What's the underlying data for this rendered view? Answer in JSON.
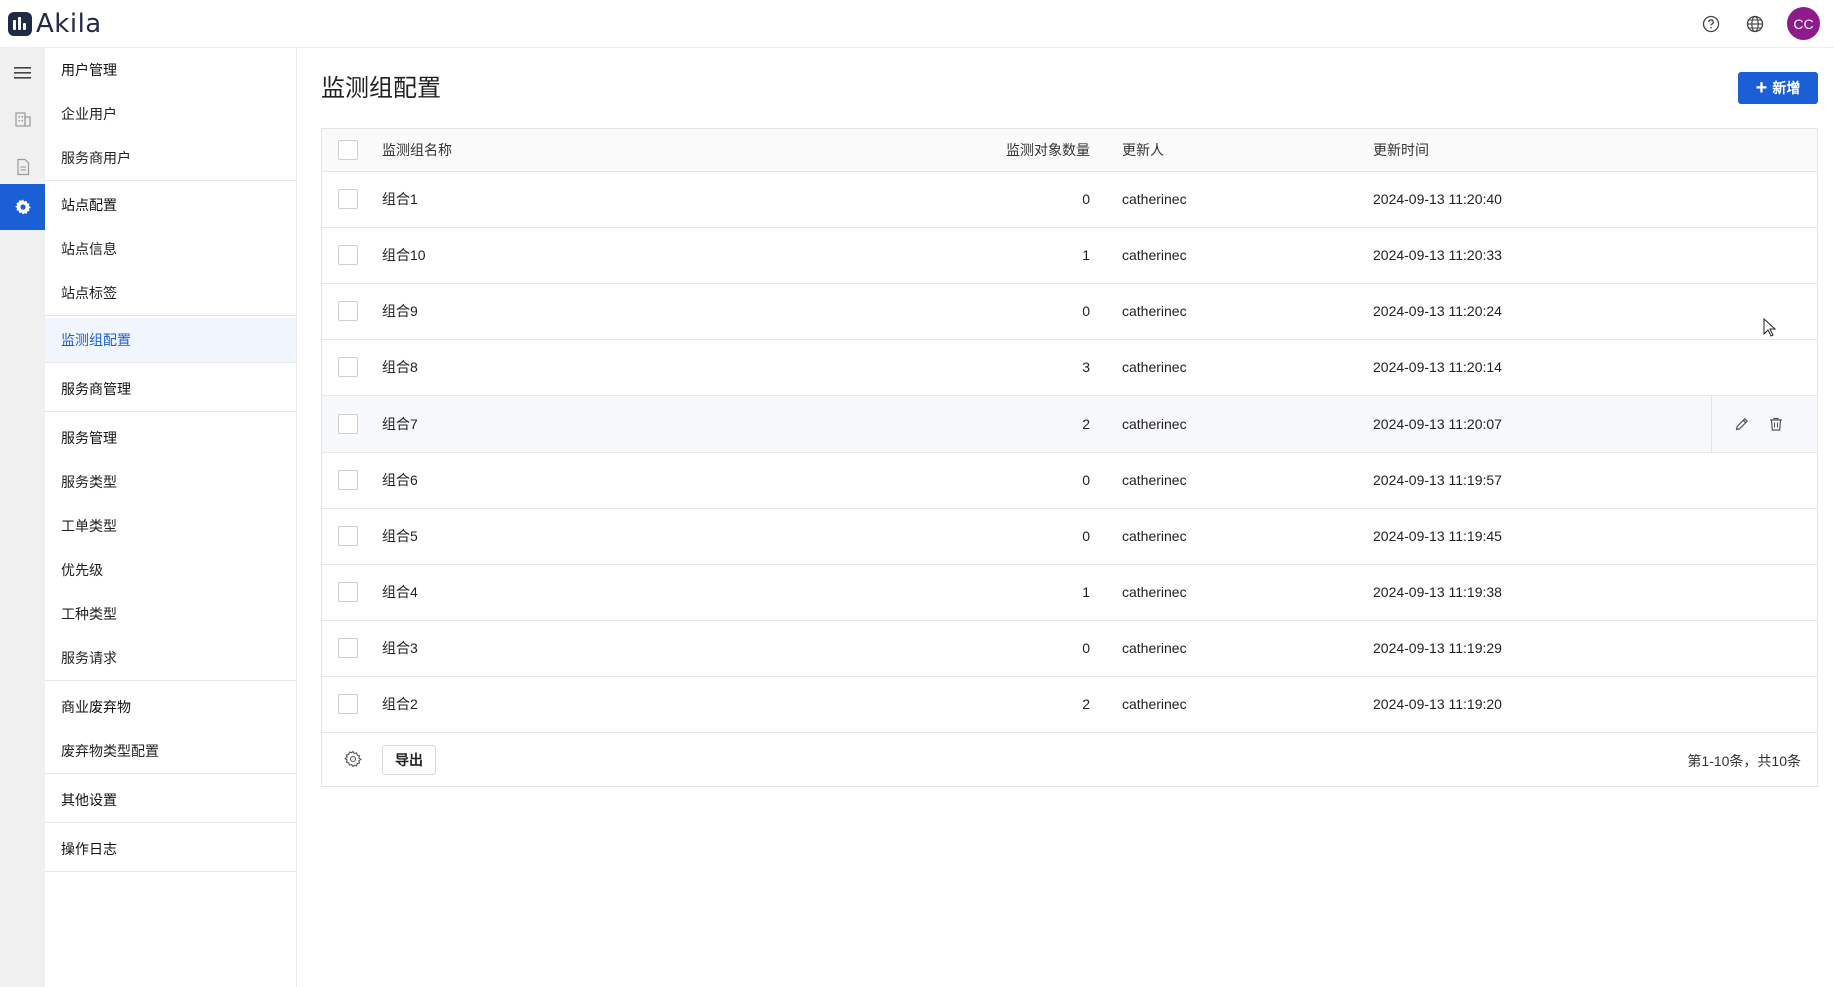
{
  "app": {
    "logo_text": "Akila",
    "avatar_initials": "CC"
  },
  "topbar": {
    "icons": [
      "help-icon",
      "globe-icon"
    ]
  },
  "rail": {
    "icons": [
      "menu-icon",
      "building-icon",
      "document-icon",
      "gear-icon"
    ],
    "active": "gear-icon"
  },
  "sidebar": {
    "groups": [
      {
        "items": [
          {
            "label": "用户管理"
          },
          {
            "label": "企业用户"
          },
          {
            "label": "服务商用户"
          }
        ]
      },
      {
        "items": [
          {
            "label": "站点配置"
          },
          {
            "label": "站点信息"
          },
          {
            "label": "站点标签"
          }
        ]
      },
      {
        "items": [
          {
            "label": "监测组配置",
            "active": true
          }
        ]
      },
      {
        "items": [
          {
            "label": "服务商管理"
          }
        ]
      },
      {
        "items": [
          {
            "label": "服务管理"
          },
          {
            "label": "服务类型"
          },
          {
            "label": "工单类型"
          },
          {
            "label": "优先级"
          },
          {
            "label": "工种类型"
          },
          {
            "label": "服务请求"
          }
        ]
      },
      {
        "items": [
          {
            "label": "商业废弃物"
          },
          {
            "label": "废弃物类型配置"
          }
        ]
      },
      {
        "items": [
          {
            "label": "其他设置"
          }
        ]
      },
      {
        "items": [
          {
            "label": "操作日志"
          }
        ]
      }
    ]
  },
  "main": {
    "title": "监测组配置",
    "add_button": "新增",
    "table": {
      "headers": {
        "name": "监测组名称",
        "count": "监测对象数量",
        "updater": "更新人",
        "time": "更新时间"
      },
      "rows": [
        {
          "name": "组合1",
          "count": "0",
          "updater": "catherinec",
          "time": "2024-09-13 11:20:40"
        },
        {
          "name": "组合10",
          "count": "1",
          "updater": "catherinec",
          "time": "2024-09-13 11:20:33"
        },
        {
          "name": "组合9",
          "count": "0",
          "updater": "catherinec",
          "time": "2024-09-13 11:20:24"
        },
        {
          "name": "组合8",
          "count": "3",
          "updater": "catherinec",
          "time": "2024-09-13 11:20:14"
        },
        {
          "name": "组合7",
          "count": "2",
          "updater": "catherinec",
          "time": "2024-09-13 11:20:07",
          "hovered": true
        },
        {
          "name": "组合6",
          "count": "0",
          "updater": "catherinec",
          "time": "2024-09-13 11:19:57"
        },
        {
          "name": "组合5",
          "count": "0",
          "updater": "catherinec",
          "time": "2024-09-13 11:19:45"
        },
        {
          "name": "组合4",
          "count": "1",
          "updater": "catherinec",
          "time": "2024-09-13 11:19:38"
        },
        {
          "name": "组合3",
          "count": "0",
          "updater": "catherinec",
          "time": "2024-09-13 11:19:29"
        },
        {
          "name": "组合2",
          "count": "2",
          "updater": "catherinec",
          "time": "2024-09-13 11:19:20"
        }
      ],
      "row_actions": [
        "edit-icon",
        "delete-icon"
      ]
    },
    "footer": {
      "export_label": "导出",
      "pagination": "第1-10条，共10条"
    }
  },
  "colors": {
    "primary": "#1b5fd6",
    "avatar": "#8e1b8e",
    "logo": "#1f2a44"
  }
}
